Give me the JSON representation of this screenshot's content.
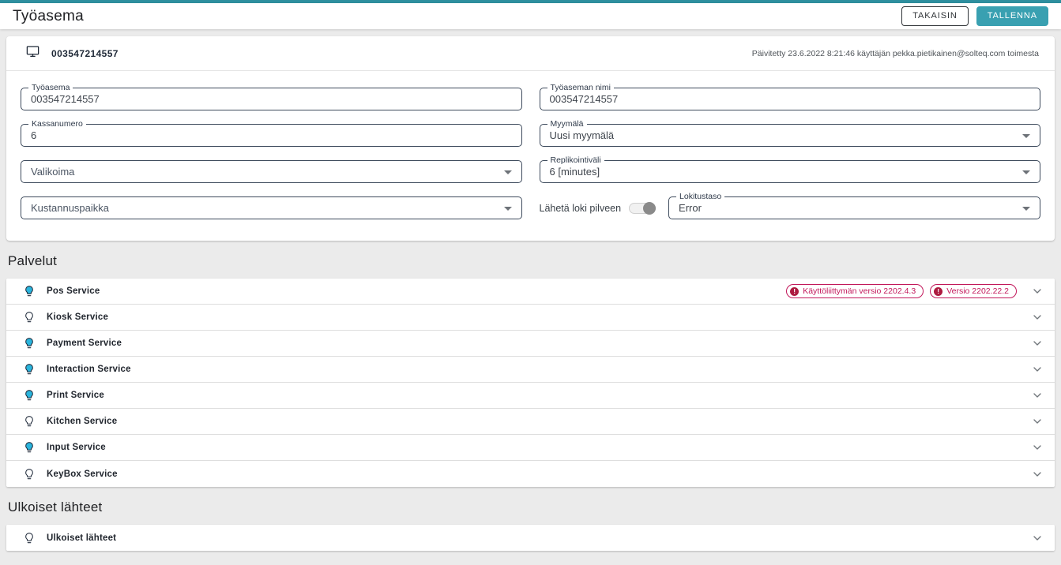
{
  "colors": {
    "accent_teal": "#39a0b1",
    "badge_pink": "#c2185b"
  },
  "header": {
    "title": "Työasema",
    "back_label": "TAKAISIN",
    "save_label": "TALLENNA"
  },
  "workstation": {
    "device_id": "003547214557",
    "updated_text": "Päivitetty 23.6.2022 8:21:46 käyttäjän pekka.pietikainen@solteq.com toimesta"
  },
  "form": {
    "tyoasema": {
      "label": "Työasema",
      "value": "003547214557"
    },
    "tyoaseman_nimi": {
      "label": "Työaseman nimi",
      "value": "003547214557"
    },
    "kassanumero": {
      "label": "Kassanumero",
      "value": "6"
    },
    "myymala": {
      "label": "Myymälä",
      "value": "Uusi myymälä"
    },
    "valikoima": {
      "label": "Valikoima"
    },
    "replikointivali": {
      "label": "Replikointiväli",
      "value": "6 [minutes]"
    },
    "kustannuspaikka": {
      "label": "Kustannuspaikka"
    },
    "laheta_loki": {
      "label": "Lähetä loki pilveen"
    },
    "lokitustaso": {
      "label": "Lokitustaso",
      "value": "Error"
    }
  },
  "services": {
    "heading": "Palvelut",
    "items": [
      {
        "label": "Pos Service",
        "state": "on",
        "badges": [
          {
            "icon": "error-icon",
            "text": "Käyttöliittymän versio 2202.4.3"
          },
          {
            "icon": "error-icon",
            "text": "Versio 2202.22.2"
          }
        ]
      },
      {
        "label": "Kiosk Service",
        "state": "off"
      },
      {
        "label": "Payment Service",
        "state": "on"
      },
      {
        "label": "Interaction Service",
        "state": "on"
      },
      {
        "label": "Print Service",
        "state": "on"
      },
      {
        "label": "Kitchen Service",
        "state": "off"
      },
      {
        "label": "Input Service",
        "state": "on"
      },
      {
        "label": "KeyBox Service",
        "state": "off"
      }
    ]
  },
  "external": {
    "heading": "Ulkoiset lähteet",
    "items": [
      {
        "label": "Ulkoiset lähteet",
        "state": "off"
      }
    ]
  }
}
